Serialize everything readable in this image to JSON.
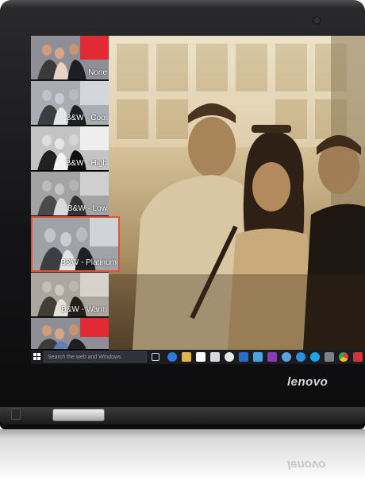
{
  "brand": {
    "logo_text": "lenovo"
  },
  "filters": {
    "items": [
      {
        "label": "None",
        "tone": "color"
      },
      {
        "label": "B&W - Cool",
        "tone": "bw"
      },
      {
        "label": "B&W - High",
        "tone": "bw"
      },
      {
        "label": "B&W - Low",
        "tone": "bw"
      },
      {
        "label": "B&W - Platinum",
        "tone": "bw",
        "selected": true
      },
      {
        "label": "B&W - Warm",
        "tone": "bw"
      },
      {
        "label": "",
        "tone": "color"
      }
    ]
  },
  "taskbar": {
    "search_placeholder": "Search the web and Windows",
    "icons": [
      "task-view-icon",
      "edge-icon",
      "file-explorer-icon",
      "store-icon",
      "calculator-icon",
      "weather-icon",
      "outlook-icon",
      "photos-icon",
      "onenote-icon",
      "people-icon",
      "internet-explorer-icon",
      "skype-icon",
      "sound-icon",
      "chrome-icon",
      "lenovo-app-icon"
    ]
  },
  "colors": {
    "selection_accent": "#e0523a",
    "taskbar_bg": "#1a1c22",
    "sepia_light": "#ece1c6",
    "sepia_dark": "#5f4a30"
  }
}
